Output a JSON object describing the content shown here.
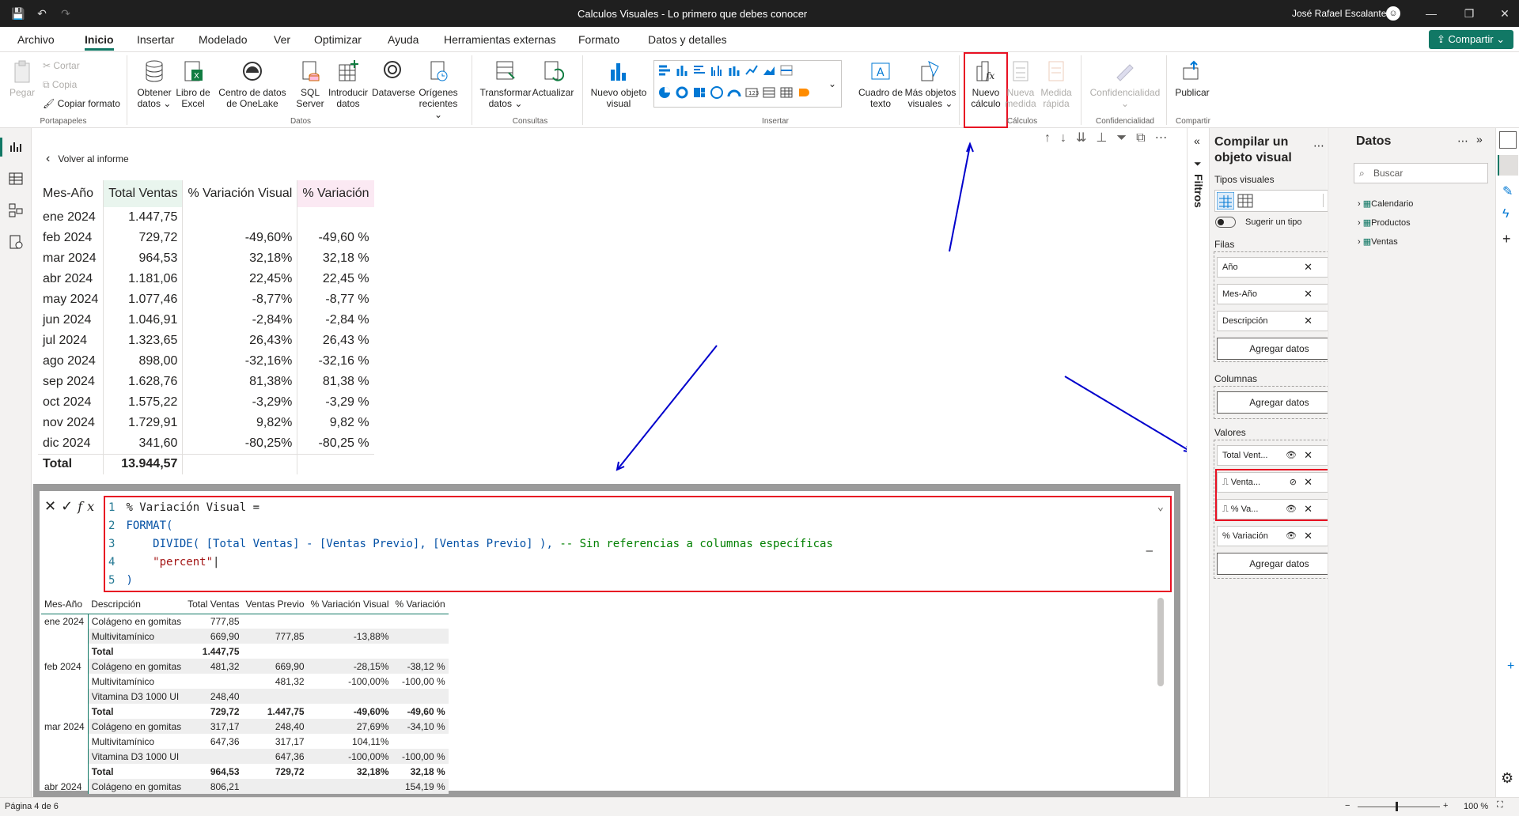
{
  "window": {
    "title": "Calculos Visuales - Lo primero que debes conocer",
    "user": "José Rafael Escalante"
  },
  "menu": {
    "items": [
      "Archivo",
      "Inicio",
      "Insertar",
      "Modelado",
      "Ver",
      "Optimizar",
      "Ayuda",
      "Herramientas externas",
      "Formato",
      "Datos y detalles"
    ],
    "share": "Compartir"
  },
  "ribbon": {
    "clipboard": {
      "paste": "Pegar",
      "cut": "Cortar",
      "copy": "Copia",
      "format": "Copiar formato",
      "group": "Portapapeles"
    },
    "data": {
      "get": "Obtener datos",
      "excel": "Libro de Excel",
      "onelake": "Centro de datos de OneLake",
      "sql": "SQL Server",
      "enter": "Introducir datos",
      "dataverse": "Dataverse",
      "recent": "Orígenes recientes",
      "group": "Datos"
    },
    "queries": {
      "transform": "Transformar datos",
      "refresh": "Actualizar",
      "group": "Consultas"
    },
    "insert": {
      "new_visual": "Nuevo objeto visual",
      "textbox": "Cuadro de texto",
      "more": "Más objetos visuales",
      "group": "Insertar"
    },
    "calc": {
      "new_calc": "Nuevo cálculo",
      "new_measure": "Nueva medida",
      "quick": "Medida rápida",
      "group": "Cálculos"
    },
    "sens": {
      "label": "Confidencialidad",
      "group": "Confidencialidad"
    },
    "share": {
      "publish": "Publicar",
      "group": "Compartir"
    }
  },
  "canvas": {
    "back": "Volver al informe"
  },
  "matrix": {
    "headers": [
      "Mes-Año",
      "Total Ventas",
      "% Variación Visual",
      "% Variación"
    ],
    "header_colors": [
      "#ffffff",
      "#e9f5ee",
      "#ffffff",
      "#fbe9f3"
    ],
    "rows": [
      [
        "ene 2024",
        "1.447,75",
        "",
        ""
      ],
      [
        "feb 2024",
        "729,72",
        "-49,60%",
        "-49,60 %"
      ],
      [
        "mar 2024",
        "964,53",
        "32,18%",
        "32,18 %"
      ],
      [
        "abr 2024",
        "1.181,06",
        "22,45%",
        "22,45 %"
      ],
      [
        "may 2024",
        "1.077,46",
        "-8,77%",
        "-8,77 %"
      ],
      [
        "jun 2024",
        "1.046,91",
        "-2,84%",
        "-2,84 %"
      ],
      [
        "jul 2024",
        "1.323,65",
        "26,43%",
        "26,43 %"
      ],
      [
        "ago 2024",
        "898,00",
        "-32,16%",
        "-32,16 %"
      ],
      [
        "sep 2024",
        "1.628,76",
        "81,38%",
        "81,38 %"
      ],
      [
        "oct 2024",
        "1.575,22",
        "-3,29%",
        "-3,29 %"
      ],
      [
        "nov 2024",
        "1.729,91",
        "9,82%",
        "9,82 %"
      ],
      [
        "dic 2024",
        "341,60",
        "-80,25%",
        "-80,25 %"
      ]
    ],
    "total": [
      "Total",
      "13.944,57",
      "",
      ""
    ]
  },
  "formula": {
    "line1": "% Variación Visual =",
    "line2": "FORMAT(",
    "line3a": "DIVIDE( [Total Ventas] - [Ventas Previo], [Ventas Previo] ),",
    "line3b": " -- Sin referencias a columnas específicas",
    "line4": "\"percent\"",
    "line5": ")"
  },
  "detail": {
    "headers": [
      "Mes-Año",
      "Descripción",
      "Total Ventas",
      "Ventas Previo",
      "% Variación Visual",
      "% Variación"
    ],
    "rows": [
      [
        "ene 2024",
        "Colágeno en gomitas",
        "777,85",
        "",
        "",
        ""
      ],
      [
        "",
        "Multivitamínico",
        "669,90",
        "777,85",
        "-13,88%",
        ""
      ],
      [
        "",
        "Total",
        "1.447,75",
        "",
        "",
        ""
      ],
      [
        "feb 2024",
        "Colágeno en gomitas",
        "481,32",
        "669,90",
        "-28,15%",
        "-38,12 %"
      ],
      [
        "",
        "Multivitamínico",
        "",
        "481,32",
        "-100,00%",
        "-100,00 %"
      ],
      [
        "",
        "Vitamina D3 1000 UI",
        "248,40",
        "",
        "",
        ""
      ],
      [
        "",
        "Total",
        "729,72",
        "1.447,75",
        "-49,60%",
        "-49,60 %"
      ],
      [
        "mar 2024",
        "Colágeno en gomitas",
        "317,17",
        "248,40",
        "27,69%",
        "-34,10 %"
      ],
      [
        "",
        "Multivitamínico",
        "647,36",
        "317,17",
        "104,11%",
        ""
      ],
      [
        "",
        "Vitamina D3 1000 UI",
        "",
        "647,36",
        "-100,00%",
        "-100,00 %"
      ],
      [
        "",
        "Total",
        "964,53",
        "729,72",
        "32,18%",
        "32,18 %"
      ],
      [
        "abr 2024",
        "Colágeno en gomitas",
        "806,21",
        "",
        "",
        "154,19 %"
      ]
    ]
  },
  "filters": {
    "label": "Filtros"
  },
  "build": {
    "title": "Compilar un objeto visual",
    "types": "Tipos visuales",
    "suggest": "Sugerir un tipo",
    "rows": "Filas",
    "columns": "Columnas",
    "values": "Valores",
    "add": "Agregar datos",
    "row_fields": [
      "Año",
      "Mes-Año",
      "Descripción"
    ],
    "value_fields": [
      "Total Vent...",
      "Venta...",
      "% Va...",
      "% Variación"
    ]
  },
  "datapane": {
    "title": "Datos",
    "search": "Buscar",
    "tables": [
      "Calendario",
      "Productos",
      "Ventas"
    ]
  },
  "status": {
    "page": "Página 4 de 6",
    "zoom": "100 %"
  }
}
